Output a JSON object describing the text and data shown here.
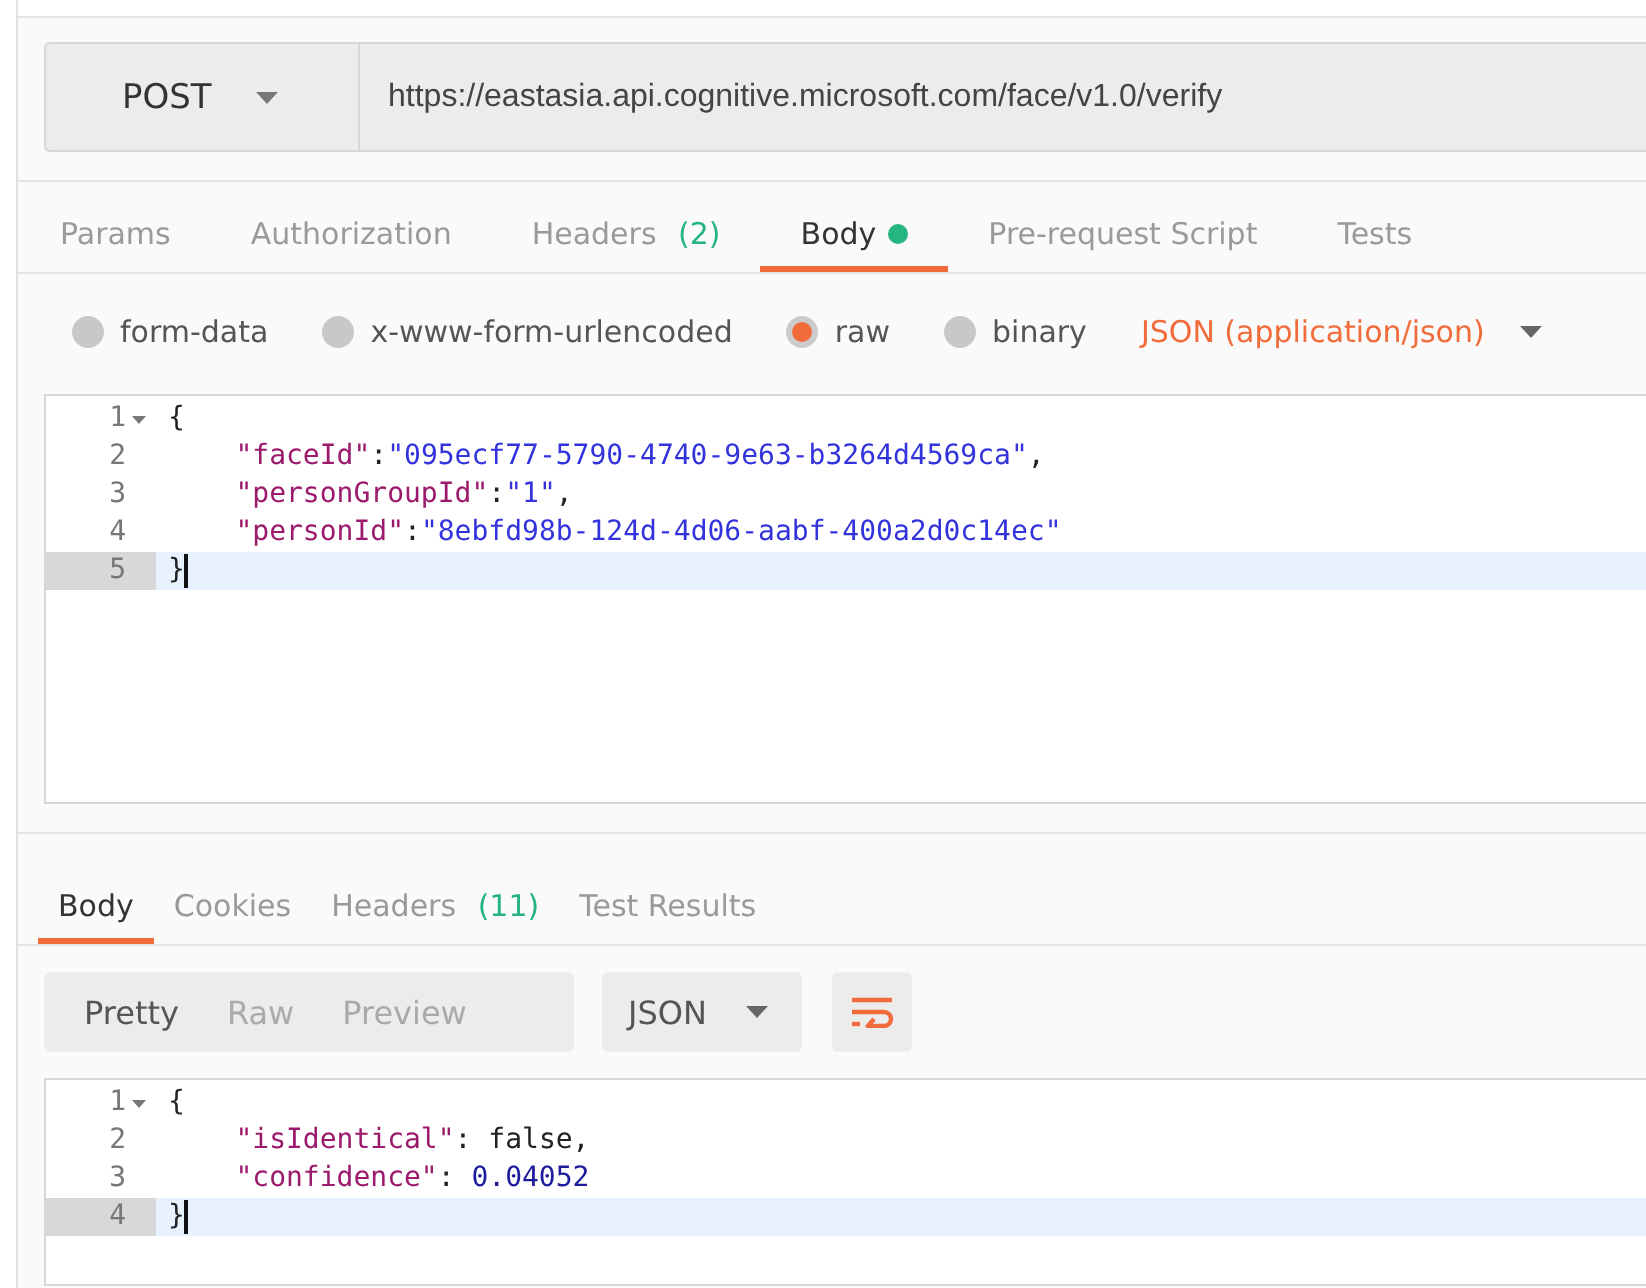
{
  "request": {
    "method": "POST",
    "url": "https://eastasia.api.cognitive.microsoft.com/face/v1.0/verify",
    "tabs": [
      {
        "label": "Params",
        "selected": false
      },
      {
        "label": "Authorization",
        "selected": false
      },
      {
        "label": "Headers",
        "count": "(2)",
        "selected": false
      },
      {
        "label": "Body",
        "dot": true,
        "selected": true
      },
      {
        "label": "Pre-request Script",
        "selected": false
      },
      {
        "label": "Tests",
        "selected": false
      }
    ],
    "body_modes": [
      {
        "label": "form-data",
        "selected": false
      },
      {
        "label": "x-www-form-urlencoded",
        "selected": false
      },
      {
        "label": "raw",
        "selected": true
      },
      {
        "label": "binary",
        "selected": false
      }
    ],
    "content_type": "JSON (application/json)",
    "editor": {
      "lines": [
        {
          "number": "1",
          "foldable": true,
          "active": false,
          "tokens": [
            {
              "kind": "punct",
              "text": "{"
            }
          ]
        },
        {
          "number": "2",
          "foldable": false,
          "active": false,
          "tokens": [
            {
              "kind": "key",
              "text": "    \"faceId\""
            },
            {
              "kind": "punct",
              "text": ":"
            },
            {
              "kind": "string",
              "text": "\"095ecf77-5790-4740-9e63-b3264d4569ca\""
            },
            {
              "kind": "punct",
              "text": ","
            }
          ]
        },
        {
          "number": "3",
          "foldable": false,
          "active": false,
          "tokens": [
            {
              "kind": "key",
              "text": "    \"personGroupId\""
            },
            {
              "kind": "punct",
              "text": ":"
            },
            {
              "kind": "string",
              "text": "\"1\""
            },
            {
              "kind": "punct",
              "text": ","
            }
          ]
        },
        {
          "number": "4",
          "foldable": false,
          "active": false,
          "tokens": [
            {
              "kind": "key",
              "text": "    \"personId\""
            },
            {
              "kind": "punct",
              "text": ":"
            },
            {
              "kind": "string",
              "text": "\"8ebfd98b-124d-4d06-aabf-400a2d0c14ec\""
            }
          ]
        },
        {
          "number": "5",
          "foldable": false,
          "active": true,
          "tokens": [
            {
              "kind": "punct",
              "text": "}"
            }
          ]
        }
      ]
    }
  },
  "response": {
    "tabs": [
      {
        "label": "Body",
        "selected": true
      },
      {
        "label": "Cookies",
        "selected": false
      },
      {
        "label": "Headers",
        "count": "(11)",
        "selected": false
      },
      {
        "label": "Test Results",
        "selected": false
      }
    ],
    "view_modes": [
      {
        "label": "Pretty",
        "selected": true
      },
      {
        "label": "Raw",
        "selected": false
      },
      {
        "label": "Preview",
        "selected": false
      }
    ],
    "format": "JSON",
    "editor": {
      "lines": [
        {
          "number": "1",
          "foldable": true,
          "active": false,
          "tokens": [
            {
              "kind": "punct",
              "text": "{"
            }
          ]
        },
        {
          "number": "2",
          "foldable": false,
          "active": false,
          "tokens": [
            {
              "kind": "key",
              "text": "    \"isIdentical\""
            },
            {
              "kind": "punct",
              "text": ": false,"
            }
          ]
        },
        {
          "number": "3",
          "foldable": false,
          "active": false,
          "tokens": [
            {
              "kind": "key",
              "text": "    \"confidence\""
            },
            {
              "kind": "punct",
              "text": ": "
            },
            {
              "kind": "number",
              "text": "0.04052"
            }
          ]
        },
        {
          "number": "4",
          "foldable": false,
          "active": true,
          "tokens": [
            {
              "kind": "punct",
              "text": "}"
            }
          ]
        }
      ]
    }
  }
}
